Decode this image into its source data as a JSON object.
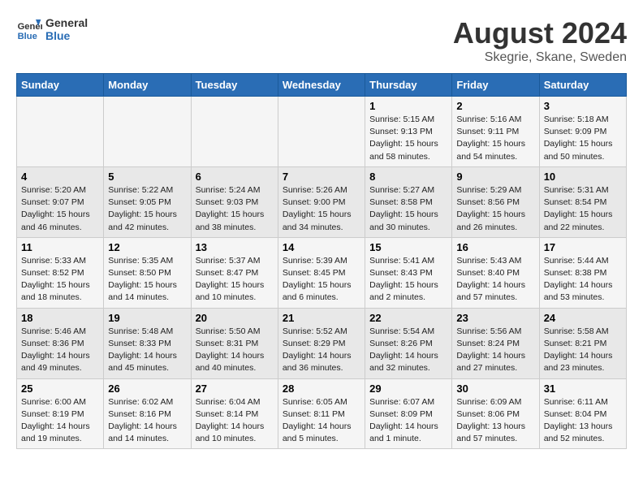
{
  "header": {
    "logo_line1": "General",
    "logo_line2": "Blue",
    "title": "August 2024",
    "subtitle": "Skegrie, Skane, Sweden"
  },
  "days_of_week": [
    "Sunday",
    "Monday",
    "Tuesday",
    "Wednesday",
    "Thursday",
    "Friday",
    "Saturday"
  ],
  "weeks": [
    [
      {
        "day": "",
        "info": ""
      },
      {
        "day": "",
        "info": ""
      },
      {
        "day": "",
        "info": ""
      },
      {
        "day": "",
        "info": ""
      },
      {
        "day": "1",
        "info": "Sunrise: 5:15 AM\nSunset: 9:13 PM\nDaylight: 15 hours\nand 58 minutes."
      },
      {
        "day": "2",
        "info": "Sunrise: 5:16 AM\nSunset: 9:11 PM\nDaylight: 15 hours\nand 54 minutes."
      },
      {
        "day": "3",
        "info": "Sunrise: 5:18 AM\nSunset: 9:09 PM\nDaylight: 15 hours\nand 50 minutes."
      }
    ],
    [
      {
        "day": "4",
        "info": "Sunrise: 5:20 AM\nSunset: 9:07 PM\nDaylight: 15 hours\nand 46 minutes."
      },
      {
        "day": "5",
        "info": "Sunrise: 5:22 AM\nSunset: 9:05 PM\nDaylight: 15 hours\nand 42 minutes."
      },
      {
        "day": "6",
        "info": "Sunrise: 5:24 AM\nSunset: 9:03 PM\nDaylight: 15 hours\nand 38 minutes."
      },
      {
        "day": "7",
        "info": "Sunrise: 5:26 AM\nSunset: 9:00 PM\nDaylight: 15 hours\nand 34 minutes."
      },
      {
        "day": "8",
        "info": "Sunrise: 5:27 AM\nSunset: 8:58 PM\nDaylight: 15 hours\nand 30 minutes."
      },
      {
        "day": "9",
        "info": "Sunrise: 5:29 AM\nSunset: 8:56 PM\nDaylight: 15 hours\nand 26 minutes."
      },
      {
        "day": "10",
        "info": "Sunrise: 5:31 AM\nSunset: 8:54 PM\nDaylight: 15 hours\nand 22 minutes."
      }
    ],
    [
      {
        "day": "11",
        "info": "Sunrise: 5:33 AM\nSunset: 8:52 PM\nDaylight: 15 hours\nand 18 minutes."
      },
      {
        "day": "12",
        "info": "Sunrise: 5:35 AM\nSunset: 8:50 PM\nDaylight: 15 hours\nand 14 minutes."
      },
      {
        "day": "13",
        "info": "Sunrise: 5:37 AM\nSunset: 8:47 PM\nDaylight: 15 hours\nand 10 minutes."
      },
      {
        "day": "14",
        "info": "Sunrise: 5:39 AM\nSunset: 8:45 PM\nDaylight: 15 hours\nand 6 minutes."
      },
      {
        "day": "15",
        "info": "Sunrise: 5:41 AM\nSunset: 8:43 PM\nDaylight: 15 hours\nand 2 minutes."
      },
      {
        "day": "16",
        "info": "Sunrise: 5:43 AM\nSunset: 8:40 PM\nDaylight: 14 hours\nand 57 minutes."
      },
      {
        "day": "17",
        "info": "Sunrise: 5:44 AM\nSunset: 8:38 PM\nDaylight: 14 hours\nand 53 minutes."
      }
    ],
    [
      {
        "day": "18",
        "info": "Sunrise: 5:46 AM\nSunset: 8:36 PM\nDaylight: 14 hours\nand 49 minutes."
      },
      {
        "day": "19",
        "info": "Sunrise: 5:48 AM\nSunset: 8:33 PM\nDaylight: 14 hours\nand 45 minutes."
      },
      {
        "day": "20",
        "info": "Sunrise: 5:50 AM\nSunset: 8:31 PM\nDaylight: 14 hours\nand 40 minutes."
      },
      {
        "day": "21",
        "info": "Sunrise: 5:52 AM\nSunset: 8:29 PM\nDaylight: 14 hours\nand 36 minutes."
      },
      {
        "day": "22",
        "info": "Sunrise: 5:54 AM\nSunset: 8:26 PM\nDaylight: 14 hours\nand 32 minutes."
      },
      {
        "day": "23",
        "info": "Sunrise: 5:56 AM\nSunset: 8:24 PM\nDaylight: 14 hours\nand 27 minutes."
      },
      {
        "day": "24",
        "info": "Sunrise: 5:58 AM\nSunset: 8:21 PM\nDaylight: 14 hours\nand 23 minutes."
      }
    ],
    [
      {
        "day": "25",
        "info": "Sunrise: 6:00 AM\nSunset: 8:19 PM\nDaylight: 14 hours\nand 19 minutes."
      },
      {
        "day": "26",
        "info": "Sunrise: 6:02 AM\nSunset: 8:16 PM\nDaylight: 14 hours\nand 14 minutes."
      },
      {
        "day": "27",
        "info": "Sunrise: 6:04 AM\nSunset: 8:14 PM\nDaylight: 14 hours\nand 10 minutes."
      },
      {
        "day": "28",
        "info": "Sunrise: 6:05 AM\nSunset: 8:11 PM\nDaylight: 14 hours\nand 5 minutes."
      },
      {
        "day": "29",
        "info": "Sunrise: 6:07 AM\nSunset: 8:09 PM\nDaylight: 14 hours\nand 1 minute."
      },
      {
        "day": "30",
        "info": "Sunrise: 6:09 AM\nSunset: 8:06 PM\nDaylight: 13 hours\nand 57 minutes."
      },
      {
        "day": "31",
        "info": "Sunrise: 6:11 AM\nSunset: 8:04 PM\nDaylight: 13 hours\nand 52 minutes."
      }
    ]
  ]
}
